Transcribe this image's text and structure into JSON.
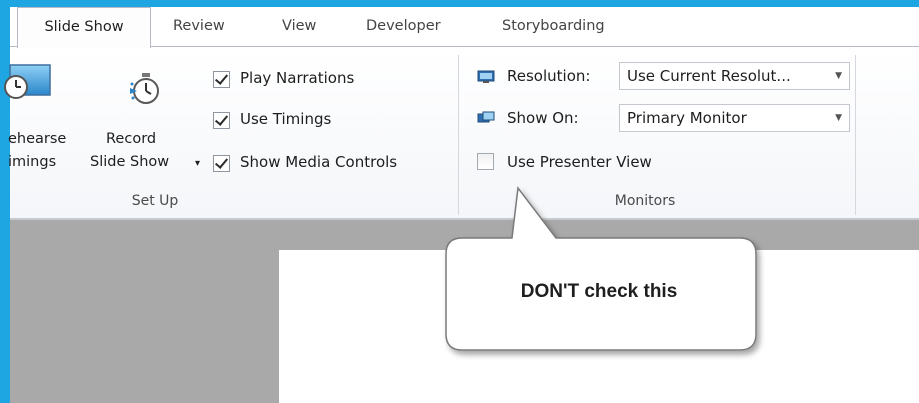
{
  "tabs": [
    {
      "label": "Slide Show",
      "active": true
    },
    {
      "label": "Review",
      "active": false
    },
    {
      "label": "View",
      "active": false
    },
    {
      "label": "Developer",
      "active": false
    },
    {
      "label": "Storyboarding",
      "active": false
    }
  ],
  "setup_group": {
    "rehearse_line1": "ehearse",
    "rehearse_line2": "imings",
    "record_line1": "Record",
    "record_line2": "Slide Show",
    "record_dropdown_glyph": "▾",
    "checkboxes": [
      {
        "label": "Play Narrations",
        "checked": true
      },
      {
        "label": "Use Timings",
        "checked": true
      },
      {
        "label": "Show Media Controls",
        "checked": true
      }
    ],
    "label": "Set Up"
  },
  "monitors_group": {
    "resolution_label": "Resolution:",
    "resolution_value": "Use Current Resolut...",
    "show_on_label": "Show On:",
    "show_on_value": "Primary Monitor",
    "presenter_view_label": "Use Presenter View",
    "presenter_view_checked": false,
    "label": "Monitors"
  },
  "callout": {
    "text": "DON'T check this"
  },
  "colors": {
    "frame_accent": "#1ea6e3",
    "workspace_gray": "#a9a9a9",
    "callout_border": "#7a7a7a"
  },
  "icons": [
    "rehearse-timings-icon",
    "record-stopwatch-icon",
    "resolution-monitor-icon",
    "show-on-monitor-icon",
    "dropdown-arrow-icon"
  ]
}
